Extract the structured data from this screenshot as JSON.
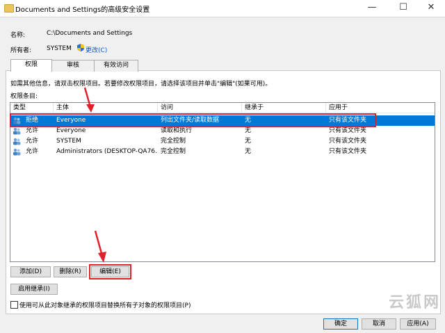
{
  "window": {
    "title": "Documents and Settings的高级安全设置",
    "minimize": "—",
    "maximize": "☐",
    "close": "✕"
  },
  "fields": {
    "name_label": "名称:",
    "name_value": "C:\\Documents and Settings",
    "owner_label": "所有者:",
    "owner_value": "SYSTEM",
    "change_link": "更改(C)"
  },
  "tabs": [
    {
      "label": "权限",
      "active": true
    },
    {
      "label": "审核",
      "active": false
    },
    {
      "label": "有效访问",
      "active": false
    }
  ],
  "info_text": "如需其他信息，请双击权限项目。若要修改权限项目，请选择该项目并单击\"编辑\"(如果可用)。",
  "list_label": "权限条目:",
  "columns": [
    "类型",
    "主体",
    "访问",
    "继承于",
    "应用于"
  ],
  "rows": [
    {
      "type": "拒绝",
      "principal": "Everyone",
      "access": "列出文件夹/读取数据",
      "inherited": "无",
      "applies": "只有该文件夹",
      "selected": true
    },
    {
      "type": "允许",
      "principal": "Everyone",
      "access": "读取和执行",
      "inherited": "无",
      "applies": "只有该文件夹",
      "selected": false
    },
    {
      "type": "允许",
      "principal": "SYSTEM",
      "access": "完全控制",
      "inherited": "无",
      "applies": "只有该文件夹",
      "selected": false
    },
    {
      "type": "允许",
      "principal": "Administrators (DESKTOP-QA76...",
      "access": "完全控制",
      "inherited": "无",
      "applies": "只有该文件夹",
      "selected": false
    }
  ],
  "buttons": {
    "add": "添加(D)",
    "remove": "删除(R)",
    "edit": "编辑(E)",
    "enable_inheritance": "启用继承(I)",
    "ok": "确定",
    "cancel": "取消",
    "apply": "应用(A)"
  },
  "replace_checkbox": "使用可从此对象继承的权限项目替换所有子对象的权限项目(P)",
  "watermark": "云狐网",
  "colors": {
    "selection": "#0078d7",
    "annotation_red": "#e0202a",
    "link": "#0a58c6"
  }
}
